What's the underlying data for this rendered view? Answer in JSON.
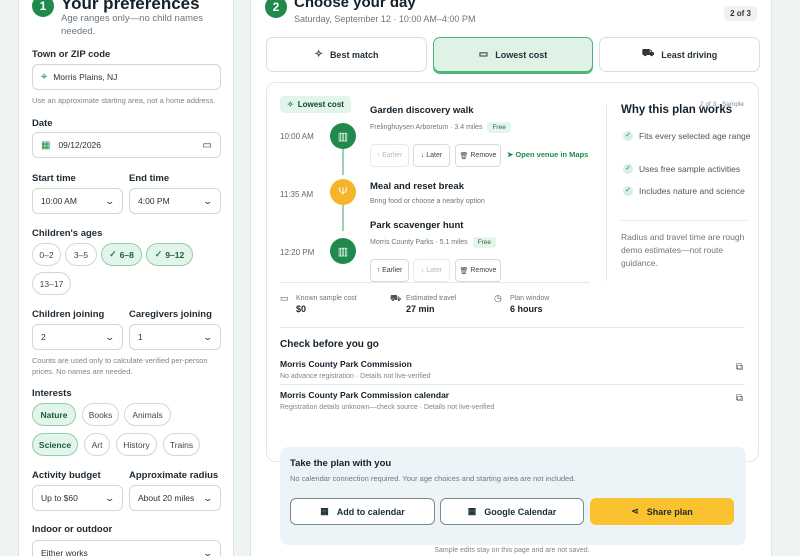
{
  "preferences": {
    "step": "1",
    "title": "Your preferences",
    "subtitle": "Age ranges only—no child names needed.",
    "town_label": "Town or ZIP code",
    "town_value": "Morris Plains, NJ",
    "town_hint": "Use an approximate starting area, not a home address.",
    "date_label": "Date",
    "date_value": "09/12/2026",
    "start_label": "Start time",
    "start_value": "10:00 AM",
    "end_label": "End time",
    "end_value": "4:00 PM",
    "ages_label": "Children's ages",
    "ages": [
      {
        "label": "0–2",
        "selected": false
      },
      {
        "label": "3–5",
        "selected": false
      },
      {
        "label": "6–8",
        "selected": true
      },
      {
        "label": "9–12",
        "selected": true
      },
      {
        "label": "13–17",
        "selected": false
      }
    ],
    "children_label": "Children joining",
    "children_value": "2",
    "caregivers_label": "Caregivers joining",
    "caregivers_value": "1",
    "counts_hint": "Counts are used only to calculate verified per-person prices. No names are needed.",
    "interests_label": "Interests",
    "interests": [
      {
        "label": "Nature",
        "selected": true
      },
      {
        "label": "Books",
        "selected": false
      },
      {
        "label": "Animals",
        "selected": false
      },
      {
        "label": "Science",
        "selected": true
      },
      {
        "label": "Art",
        "selected": false
      },
      {
        "label": "History",
        "selected": false
      },
      {
        "label": "Trains",
        "selected": false
      }
    ],
    "budget_label": "Activity budget",
    "budget_value": "Up to $60",
    "radius_label": "Approximate radius",
    "radius_value": "About 20 miles",
    "indoor_label": "Indoor or outdoor",
    "indoor_value": "Either works"
  },
  "day": {
    "step": "2",
    "title": "Choose your day",
    "subtitle": "Saturday, September 12 · 10:00 AM–4:00 PM",
    "badge": "2 of 3",
    "tabs": [
      {
        "label": "Best match",
        "icon": "sparkle-icon",
        "selected": false
      },
      {
        "label": "Lowest cost",
        "icon": "wallet-icon",
        "selected": true
      },
      {
        "label": "Least driving",
        "icon": "car-icon",
        "selected": false
      }
    ],
    "plan_pill": "Lowest cost",
    "plan_counter": "2 of 3 · Sample",
    "activities": [
      {
        "time": "10:00 AM",
        "title": "Garden discovery walk",
        "meta": "Frelinghuysen Arboretum · 3.4 miles",
        "tag": "Free",
        "icon": "book-icon",
        "color": "#1f8a4c"
      },
      {
        "time": "11:35 AM",
        "title": "Meal and reset break",
        "meta": "Bring food or choose a nearby option",
        "tag": "",
        "icon": "utensils-icon",
        "color": "#f4b52b"
      },
      {
        "time": "12:20 PM",
        "title": "Park scavenger hunt",
        "meta": "Morris County Parks · 5.1 miles",
        "tag": "Free",
        "icon": "book-icon",
        "color": "#1f8a4c"
      }
    ],
    "buttons": {
      "earlier": "Earlier",
      "later": "Later",
      "remove": "Remove",
      "maps": "Open venue in Maps"
    },
    "why_title": "Why this plan works",
    "why_items": [
      "Fits every selected age range",
      "Uses free sample activities",
      "Includes nature and science"
    ],
    "why_note": "Radius and travel time are rough demo estimates—not route guidance.",
    "summary": [
      {
        "label": "Known sample cost",
        "value": "$0",
        "icon": "wallet-icon"
      },
      {
        "label": "Estimated travel",
        "value": "27 min",
        "icon": "car-icon"
      },
      {
        "label": "Plan window",
        "value": "6 hours",
        "icon": "clock-icon"
      }
    ],
    "check_title": "Check before you go",
    "checks": [
      {
        "name": "Morris County Park Commission",
        "detail": "No advance registration · Details not live-verified"
      },
      {
        "name": "Morris County Park Commission calendar",
        "detail": "Registration details unknown—check source · Details not live-verified"
      }
    ],
    "take_title": "Take the plan with you",
    "take_sub": "No calendar connection required. Your age choices and starting area are not included.",
    "add_calendar": "Add to calendar",
    "google_calendar": "Google Calendar",
    "share": "Share plan",
    "footer": "Sample edits stay on this page and are not saved.",
    "colors": {
      "accent": "#1f8a4c",
      "share": "#f9c22e"
    }
  }
}
